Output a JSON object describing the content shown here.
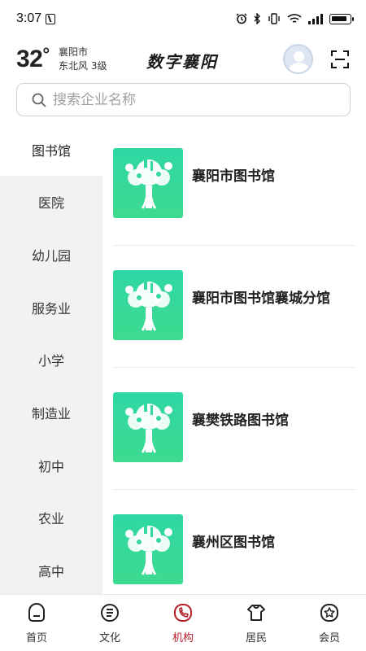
{
  "status_bar": {
    "time": "3:07"
  },
  "header": {
    "temperature": "32",
    "temperature_unit": "°",
    "city": "襄阳市",
    "wind": "东北风  3级",
    "title": "数字襄阳"
  },
  "search": {
    "placeholder": "搜索企业名称",
    "value": ""
  },
  "sidebar": {
    "active_index": 0,
    "items": [
      {
        "label": "图书馆"
      },
      {
        "label": "医院"
      },
      {
        "label": "幼儿园"
      },
      {
        "label": "服务业"
      },
      {
        "label": "小学"
      },
      {
        "label": "制造业"
      },
      {
        "label": "初中"
      },
      {
        "label": "农业"
      },
      {
        "label": "高中"
      }
    ]
  },
  "organizations": [
    {
      "name": "襄阳市图书馆"
    },
    {
      "name": "襄阳市图书馆襄城分馆"
    },
    {
      "name": "襄樊铁路图书馆"
    },
    {
      "name": "襄州区图书馆"
    }
  ],
  "bottom_nav": {
    "active_index": 2,
    "items": [
      {
        "label": "首页",
        "icon": "home-icon"
      },
      {
        "label": "文化",
        "icon": "culture-icon"
      },
      {
        "label": "机构",
        "icon": "organization-icon"
      },
      {
        "label": "居民",
        "icon": "resident-icon"
      },
      {
        "label": "会员",
        "icon": "member-icon"
      }
    ]
  },
  "colors": {
    "accent": "#b3202a",
    "thumb_green": "#34d99b",
    "sidebar_bg": "#f2f2f2"
  }
}
